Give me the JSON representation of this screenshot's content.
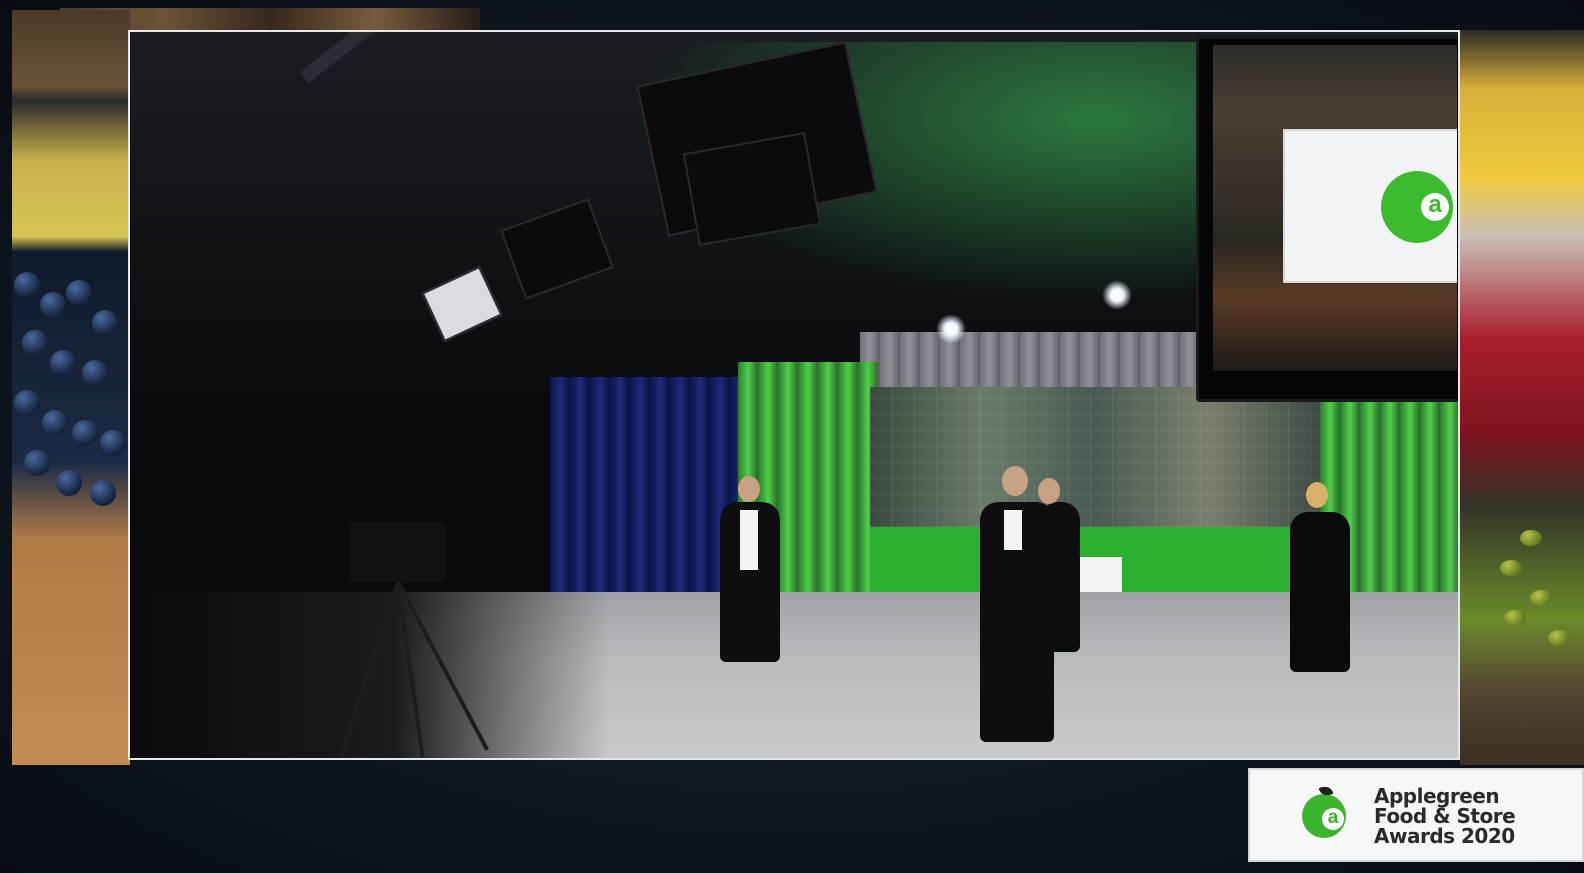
{
  "badge": {
    "line1": "Applegreen",
    "line2": "Food & Store",
    "line3": "Awards 2020",
    "logo_letter": "a"
  },
  "tv": {
    "logo_letter": "a"
  },
  "colors": {
    "brand_green": "#3ab52c",
    "stage_green": "#2bb032"
  }
}
